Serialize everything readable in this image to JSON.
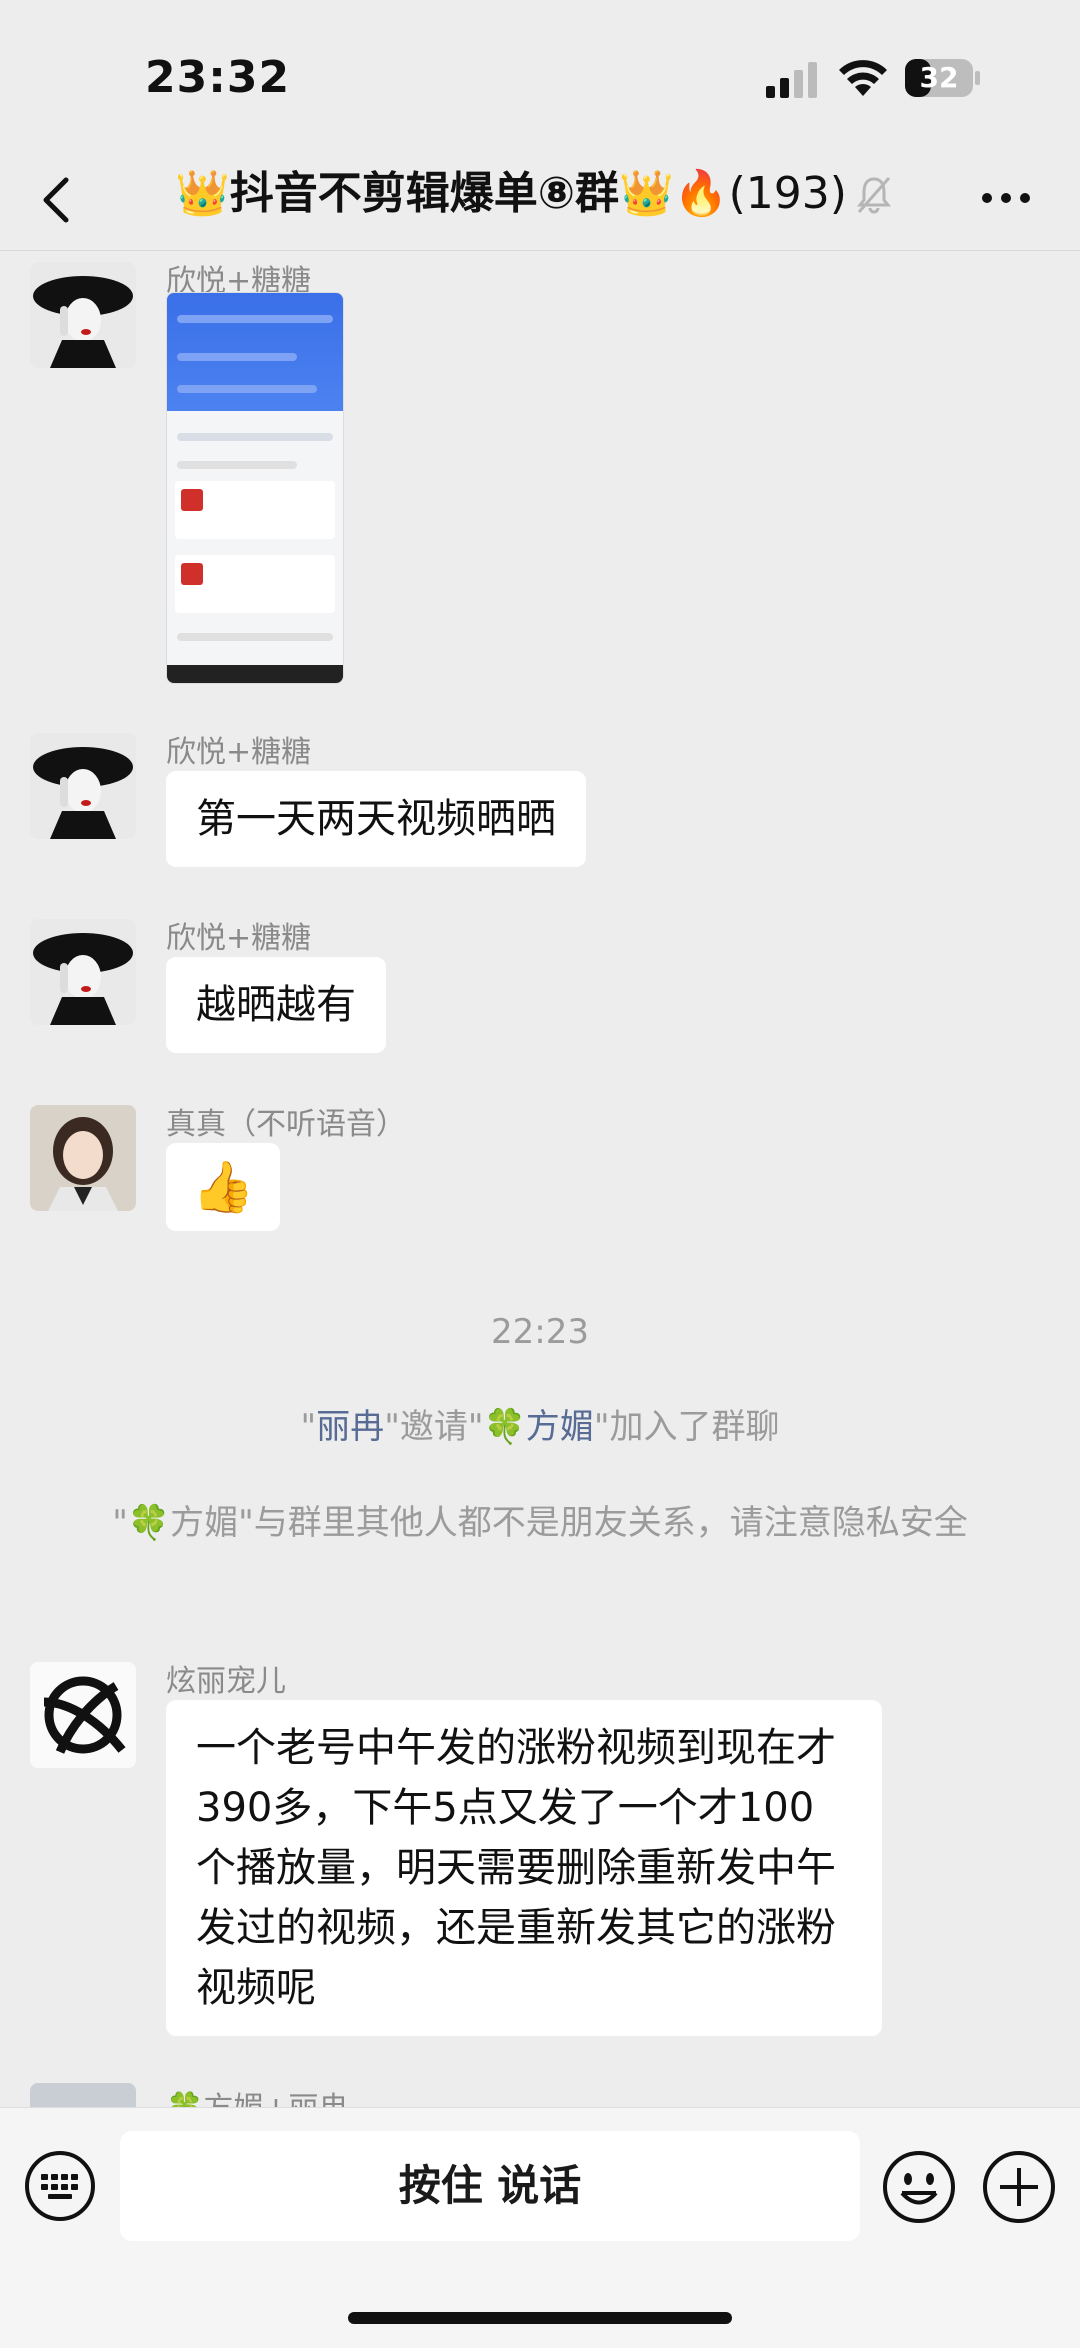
{
  "status": {
    "time": "23:32",
    "battery": "32"
  },
  "nav": {
    "title": "👑抖音不剪辑爆单⑧群👑🔥",
    "count": "(193)"
  },
  "messages": [
    {
      "sender": "欣悦+糖糖",
      "type": "image"
    },
    {
      "sender": "欣悦+糖糖",
      "text": "第一天两天视频晒晒"
    },
    {
      "sender": "欣悦+糖糖",
      "text": "越晒越有"
    },
    {
      "sender": "真真（不听语音）",
      "text": "👍"
    }
  ],
  "divider_time": "22:23",
  "system": {
    "invite": {
      "q1": "\"",
      "inviter": "丽冉",
      "mid": "\"邀请\"",
      "invitee": "🍀方媚",
      "end": "\"加入了群聊"
    },
    "privacy": "\"🍀方媚\"与群里其他人都不是朋友关系，请注意隐私安全"
  },
  "long_message": {
    "sender": "炫丽宠儿",
    "text": "一个老号中午发的涨粉视频到现在才390多，下午5点又发了一个才100个播放量，明天需要删除重新发中午发过的视频，还是重新发其它的涨粉视频呢"
  },
  "partial_sender": "🍀方媚+丽冉",
  "input": {
    "talk_label": "按住 说话"
  }
}
